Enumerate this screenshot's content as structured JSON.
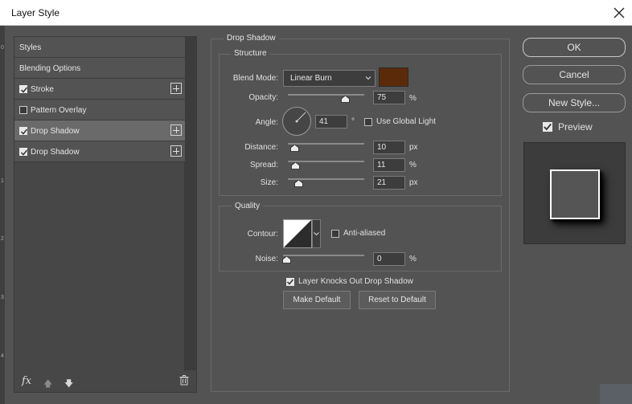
{
  "window": {
    "title": "Layer Style"
  },
  "left_panel": {
    "items": [
      {
        "label": "Styles",
        "checkbox": false,
        "checked": false,
        "plus": false,
        "selected": false
      },
      {
        "label": "Blending Options",
        "checkbox": false,
        "checked": false,
        "plus": false,
        "selected": false
      },
      {
        "label": "Stroke",
        "checkbox": true,
        "checked": true,
        "plus": true,
        "selected": false
      },
      {
        "label": "Pattern Overlay",
        "checkbox": true,
        "checked": false,
        "plus": false,
        "selected": false
      },
      {
        "label": "Drop Shadow",
        "checkbox": true,
        "checked": true,
        "plus": true,
        "selected": true
      },
      {
        "label": "Drop Shadow",
        "checkbox": true,
        "checked": true,
        "plus": true,
        "selected": false
      }
    ],
    "fx_label": "fx"
  },
  "drop_shadow": {
    "section_title": "Drop Shadow",
    "structure_title": "Structure",
    "blend_mode_label": "Blend Mode:",
    "blend_mode_value": "Linear Burn",
    "shadow_color": "#5b2b09",
    "opacity_label": "Opacity:",
    "opacity_value": "75",
    "opacity_unit": "%",
    "angle_label": "Angle:",
    "angle_value": "41",
    "angle_unit": "°",
    "use_global_light_label": "Use Global Light",
    "use_global_light_checked": false,
    "distance_label": "Distance:",
    "distance_value": "10",
    "distance_unit": "px",
    "spread_label": "Spread:",
    "spread_value": "11",
    "spread_unit": "%",
    "size_label": "Size:",
    "size_value": "21",
    "size_unit": "px",
    "quality_title": "Quality",
    "contour_label": "Contour:",
    "anti_aliased_label": "Anti-aliased",
    "anti_aliased_checked": false,
    "noise_label": "Noise:",
    "noise_value": "0",
    "noise_unit": "%",
    "knocks_out_label": "Layer Knocks Out Drop Shadow",
    "knocks_out_checked": true,
    "make_default_label": "Make Default",
    "reset_default_label": "Reset to Default"
  },
  "right_panel": {
    "ok_label": "OK",
    "cancel_label": "Cancel",
    "new_style_label": "New Style...",
    "preview_label": "Preview",
    "preview_checked": true
  },
  "edge_marks": [
    "0",
    "1",
    "2",
    "3",
    "4"
  ]
}
